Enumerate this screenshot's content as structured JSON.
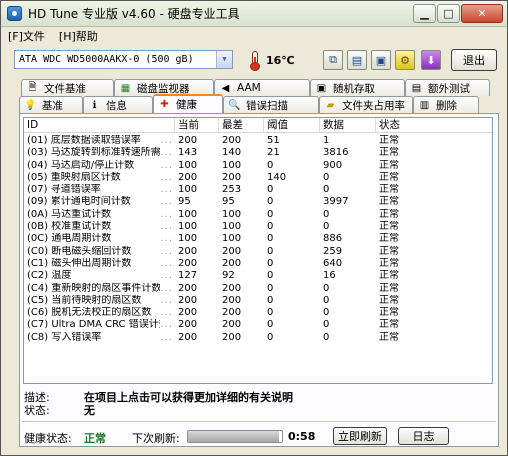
{
  "window": {
    "title": "HD Tune 专业版 v4.60 - 硬盘专业工具"
  },
  "menu": [
    {
      "label": "[F]文件"
    },
    {
      "label": "[H]帮助"
    }
  ],
  "toolbar": {
    "drive": "ATA    WDC WD5000AAKX-0 (500 gB)",
    "temperature": "16℃",
    "exit_label": "退出"
  },
  "tabs_top": [
    {
      "label": "文件基准",
      "icon": "file-icon"
    },
    {
      "label": "磁盘监视器",
      "icon": "monitor-icon"
    },
    {
      "label": "AAM",
      "icon": "speaker-icon"
    },
    {
      "label": "随机存取",
      "icon": "random-access-icon"
    },
    {
      "label": "额外测试",
      "icon": "extra-tests-icon"
    }
  ],
  "tabs_bottom": [
    {
      "label": "基准",
      "icon": "benchmark-icon"
    },
    {
      "label": "信息",
      "icon": "info-icon"
    },
    {
      "label": "健康",
      "icon": "health-icon",
      "active": true
    },
    {
      "label": "错误扫描",
      "icon": "error-scan-icon"
    },
    {
      "label": "文件夹占用率",
      "icon": "folder-icon"
    },
    {
      "label": "删除",
      "icon": "erase-icon"
    }
  ],
  "smart_table": {
    "headers": [
      "ID",
      "当前",
      "最差",
      "阈值",
      "数据",
      "状态"
    ],
    "rows": [
      {
        "id": "(01) 底层数据读取错误率",
        "current": "200",
        "worst": "200",
        "threshold": "51",
        "data": "1",
        "status": "正常"
      },
      {
        "id": "(03) 马达旋转到标准转速所需...",
        "current": "143",
        "worst": "140",
        "threshold": "21",
        "data": "3816",
        "status": "正常"
      },
      {
        "id": "(04) 马达启动/停止计数",
        "current": "100",
        "worst": "100",
        "threshold": "0",
        "data": "900",
        "status": "正常"
      },
      {
        "id": "(05) 重映射扇区计数",
        "current": "200",
        "worst": "200",
        "threshold": "140",
        "data": "0",
        "status": "正常"
      },
      {
        "id": "(07) 寻道错误率",
        "current": "100",
        "worst": "253",
        "threshold": "0",
        "data": "0",
        "status": "正常"
      },
      {
        "id": "(09) 累计通电时间计数",
        "current": "95",
        "worst": "95",
        "threshold": "0",
        "data": "3997",
        "status": "正常"
      },
      {
        "id": "(0A) 马达重试计数",
        "current": "100",
        "worst": "100",
        "threshold": "0",
        "data": "0",
        "status": "正常"
      },
      {
        "id": "(0B) 校准重试计数",
        "current": "100",
        "worst": "100",
        "threshold": "0",
        "data": "0",
        "status": "正常"
      },
      {
        "id": "(0C) 通电周期计数",
        "current": "100",
        "worst": "100",
        "threshold": "0",
        "data": "886",
        "status": "正常"
      },
      {
        "id": "(C0) 断电磁头缩回计数",
        "current": "200",
        "worst": "200",
        "threshold": "0",
        "data": "259",
        "status": "正常"
      },
      {
        "id": "(C1) 磁头伸出周期计数",
        "current": "200",
        "worst": "200",
        "threshold": "0",
        "data": "640",
        "status": "正常"
      },
      {
        "id": "(C2) 温度",
        "current": "127",
        "worst": "92",
        "threshold": "0",
        "data": "16",
        "status": "正常"
      },
      {
        "id": "(C4) 重新映射的扇区事件计数",
        "current": "200",
        "worst": "200",
        "threshold": "0",
        "data": "0",
        "status": "正常"
      },
      {
        "id": "(C5) 当前待映射的扇区数",
        "current": "200",
        "worst": "200",
        "threshold": "0",
        "data": "0",
        "status": "正常"
      },
      {
        "id": "(C6) 脱机无法校正的扇区数",
        "current": "200",
        "worst": "200",
        "threshold": "0",
        "data": "0",
        "status": "正常"
      },
      {
        "id": "(C7) Ultra DMA CRC 错误计数",
        "current": "200",
        "worst": "200",
        "threshold": "0",
        "data": "0",
        "status": "正常"
      },
      {
        "id": "(C8) 写入错误率",
        "current": "200",
        "worst": "200",
        "threshold": "0",
        "data": "0",
        "status": "正常"
      }
    ]
  },
  "details": {
    "desc_label": "描述:",
    "desc_text": "在项目上点击可以获得更加详细的有关说明",
    "status_label": "状态:",
    "status_text": "无"
  },
  "statusbar": {
    "health_label": "健康状态:",
    "health_value": "正常",
    "refresh_label": "下次刷新:",
    "countdown": "0:58",
    "refresh_progress": 0.97,
    "refresh_now_label": "立即刷新",
    "log_label": "日志"
  },
  "colors": {
    "health_ok": "#1a7a25",
    "active_tab_accent": "#e68b2c"
  }
}
